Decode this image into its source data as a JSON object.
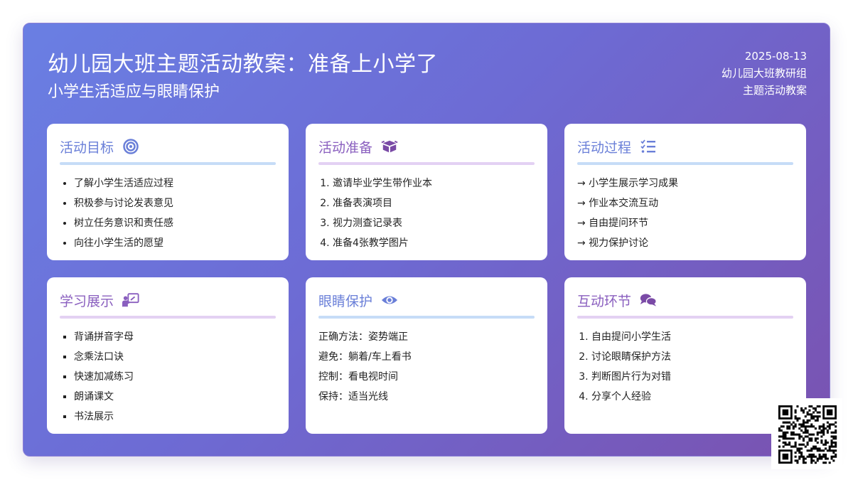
{
  "header": {
    "title": "幼儿园大班主题活动教案：准备上小学了",
    "subtitle": "小学生活适应与眼睛保护",
    "date": "2025-08-13",
    "author": "幼儿园大班教研组",
    "doc_type": "主题活动教案"
  },
  "cards": [
    {
      "title": "活动目标",
      "icon": "target-icon",
      "list_style": "bullet",
      "items": [
        "了解小学生活适应过程",
        "积极参与讨论发表意见",
        "树立任务意识和责任感",
        "向往小学生活的愿望"
      ]
    },
    {
      "title": "活动准备",
      "icon": "box-icon",
      "list_style": "numbered",
      "items": [
        "邀请毕业学生带作业本",
        "准备表演项目",
        "视力测查记录表",
        "准备4张教学图片"
      ]
    },
    {
      "title": "活动过程",
      "icon": "task-list-icon",
      "list_style": "arrow",
      "items": [
        "→ 小学生展示学习成果",
        "→ 作业本交流互动",
        "→ 自由提问环节",
        "→ 视力保护讨论"
      ]
    },
    {
      "title": "学习展示",
      "icon": "teacher-board-icon",
      "list_style": "square",
      "items": [
        "背诵拼音字母",
        "念乘法口诀",
        "快速加减练习",
        "朗诵课文",
        "书法展示"
      ]
    },
    {
      "title": "眼睛保护",
      "icon": "eye-icon",
      "list_style": "plain",
      "items": [
        "正确方法：姿势端正",
        "避免：躺着/车上看书",
        "控制：看电视时间",
        "保持：适当光线"
      ]
    },
    {
      "title": "互动环节",
      "icon": "chat-bubbles-icon",
      "list_style": "numbered",
      "items": [
        "自由提问小学生活",
        "讨论眼睛保护方法",
        "判断图片行为对错",
        "分享个人经验"
      ]
    }
  ],
  "colors": {
    "gradient_start": "#6a7fe3",
    "gradient_end": "#7a52b0",
    "accent_blue": "#6a7fd8",
    "accent_purple": "#8a5fbf"
  }
}
